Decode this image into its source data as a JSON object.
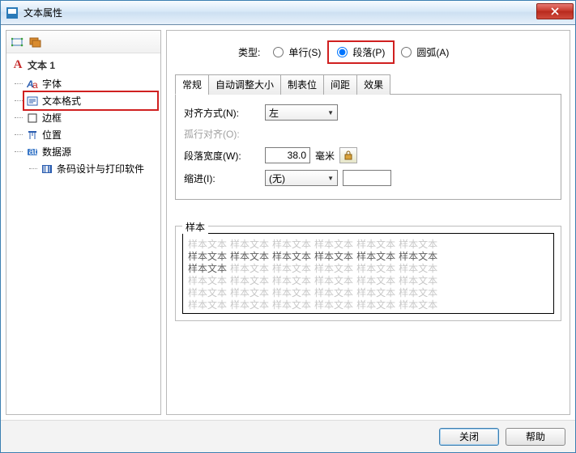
{
  "window": {
    "title": "文本属性"
  },
  "tree": {
    "root": "文本 1",
    "items": [
      {
        "label": "字体"
      },
      {
        "label": "文本格式"
      },
      {
        "label": "边框"
      },
      {
        "label": "位置"
      },
      {
        "label": "数据源",
        "children": [
          {
            "label": "条码设计与打印软件"
          }
        ]
      }
    ]
  },
  "type": {
    "label": "类型:",
    "options": [
      {
        "label": "单行(S)",
        "checked": false
      },
      {
        "label": "段落(P)",
        "checked": true
      },
      {
        "label": "圆弧(A)",
        "checked": false
      }
    ]
  },
  "tabs": [
    "常规",
    "自动调整大小",
    "制表位",
    "间距",
    "效果"
  ],
  "activeTab": 0,
  "form": {
    "align": {
      "label": "对齐方式(N):",
      "value": "左"
    },
    "orphan": {
      "label": "孤行对齐(O):"
    },
    "width": {
      "label": "段落宽度(W):",
      "value": "38.0",
      "unit": "毫米"
    },
    "indent": {
      "label": "缩进(I):",
      "value": "(无)",
      "text": ""
    }
  },
  "sample": {
    "legend": "样本",
    "word": "样本文本"
  },
  "footer": {
    "close": "关闭",
    "help": "帮助"
  },
  "colors": {
    "accentRed": "#d02020"
  }
}
